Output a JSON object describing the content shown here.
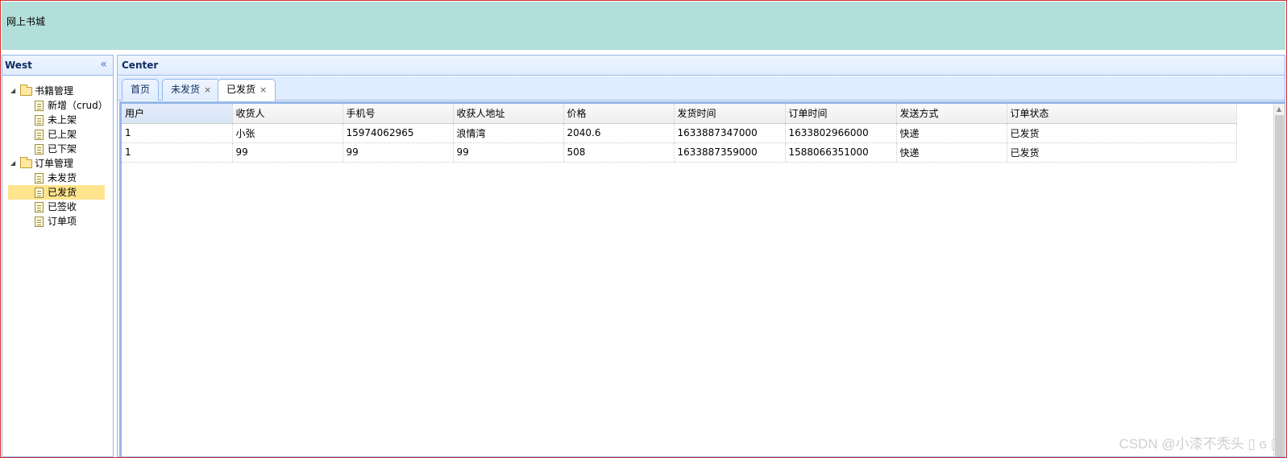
{
  "north": {
    "title": "网上书城"
  },
  "west": {
    "title": "West",
    "collapse_icon": "«",
    "tree": [
      {
        "label": "书籍管理",
        "type": "folder"
      },
      {
        "label": "新增（crud）",
        "type": "file"
      },
      {
        "label": "未上架",
        "type": "file"
      },
      {
        "label": "已上架",
        "type": "file"
      },
      {
        "label": "已下架",
        "type": "file"
      },
      {
        "label": "订单管理",
        "type": "folder"
      },
      {
        "label": "未发货",
        "type": "file"
      },
      {
        "label": "已发货",
        "type": "file",
        "selected": true
      },
      {
        "label": "已签收",
        "type": "file"
      },
      {
        "label": "订单项",
        "type": "file"
      }
    ]
  },
  "center": {
    "title": "Center",
    "tabs": [
      {
        "label": "首页",
        "closable": false
      },
      {
        "label": "未发货",
        "closable": true
      },
      {
        "label": "已发货",
        "closable": true,
        "active": true
      }
    ],
    "close_glyph": "×",
    "grid": {
      "columns": [
        "用户",
        "收货人",
        "手机号",
        "收获人地址",
        "价格",
        "发货时间",
        "订单时间",
        "发送方式",
        "订单状态"
      ],
      "rows": [
        [
          "1",
          "小张",
          "15974062965",
          "浪情湾",
          "2040.6",
          "1633887347000",
          "1633802966000",
          "快递",
          "已发货"
        ],
        [
          "1",
          "99",
          "99",
          "99",
          "508",
          "1633887359000",
          "1588066351000",
          "快递",
          "已发货"
        ]
      ]
    }
  },
  "watermark": "CSDN @小漆不秃头 ▯ ϭ ▯",
  "colors": {
    "north_bg": "#b3dfda",
    "panel_border": "#95b8e7",
    "tab_bg": "#e0ecff",
    "selected": "#ffe48d"
  }
}
